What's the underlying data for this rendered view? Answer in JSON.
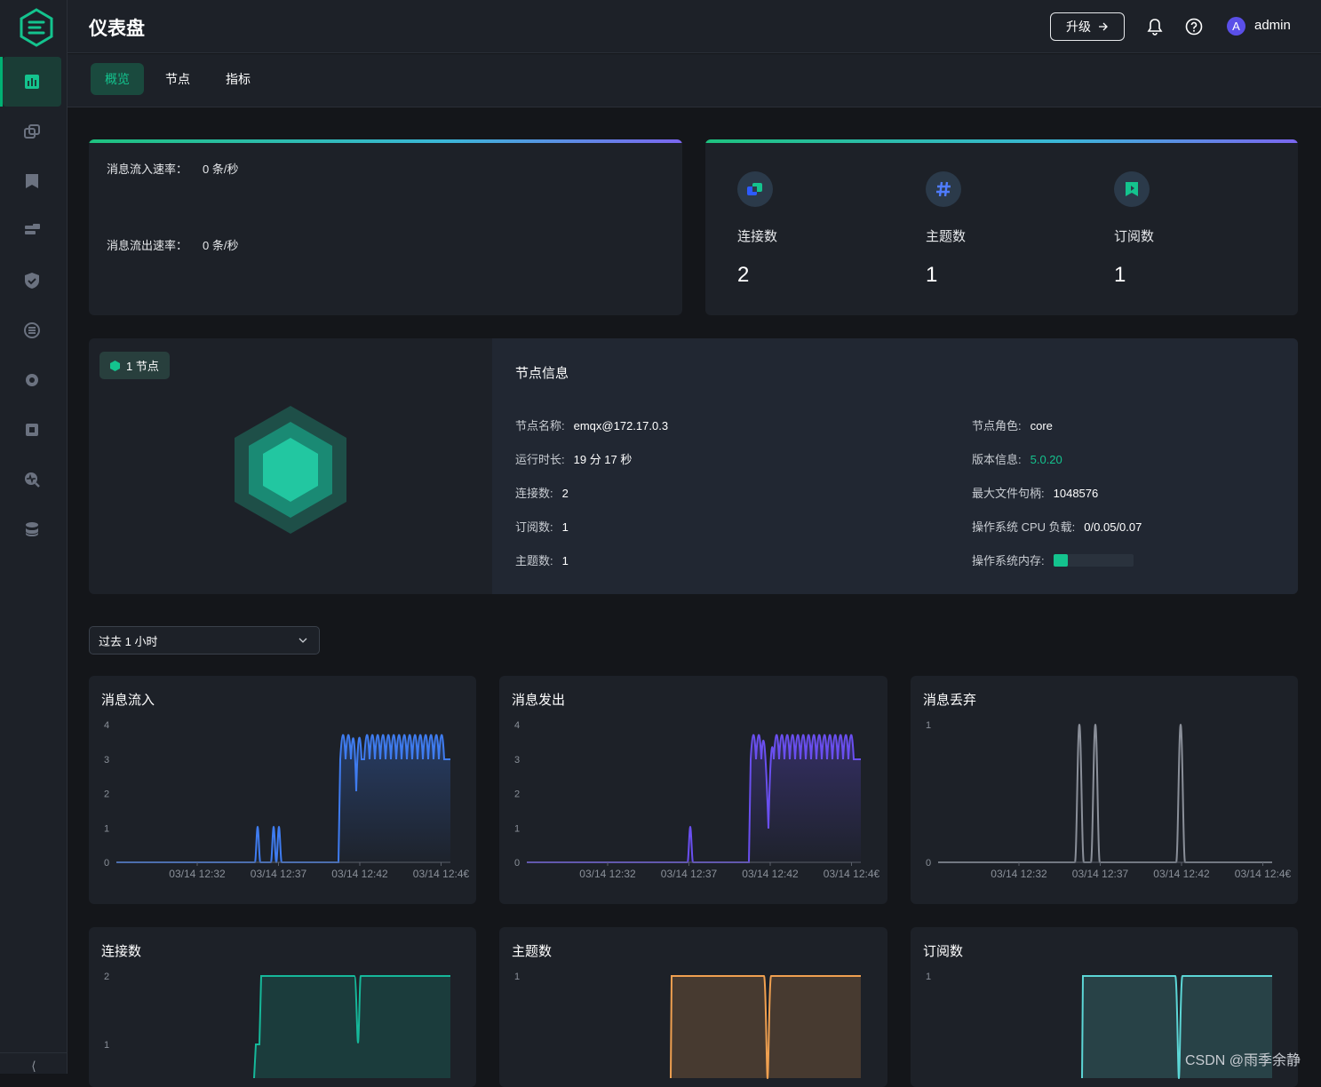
{
  "header": {
    "title": "仪表盘",
    "upgrade_label": "升级",
    "username": "admin",
    "avatar_letter": "A"
  },
  "sidebar": {
    "items": [
      {
        "icon": "dashboard-icon",
        "active": true
      },
      {
        "icon": "connections-icon"
      },
      {
        "icon": "subscribe-icon"
      },
      {
        "icon": "retained-messages-icon"
      },
      {
        "icon": "access-control-icon"
      },
      {
        "icon": "integration-icon"
      },
      {
        "icon": "management-icon"
      },
      {
        "icon": "problem-analysis-icon"
      },
      {
        "icon": "diagnose-icon"
      },
      {
        "icon": "cluster-icon"
      }
    ],
    "collapse_label": "⟨"
  },
  "tabs": [
    {
      "label": "概览",
      "active": true
    },
    {
      "label": "节点"
    },
    {
      "label": "指标"
    }
  ],
  "rates": {
    "in_label": "消息流入速率：",
    "in_value": "0 条/秒",
    "out_label": "消息流出速率：",
    "out_value": "0 条/秒"
  },
  "stats": [
    {
      "icon": "connections-stat-icon",
      "label": "连接数",
      "value": "2"
    },
    {
      "icon": "topics-stat-icon",
      "label": "主题数",
      "value": "1"
    },
    {
      "icon": "subscriptions-stat-icon",
      "label": "订阅数",
      "value": "1"
    }
  ],
  "node_badge": "1 节点",
  "node_info": {
    "title": "节点信息",
    "left": [
      {
        "key": "节点名称:",
        "value": "emqx@172.17.0.3"
      },
      {
        "key": "运行时长:",
        "value": "19 分 17 秒"
      },
      {
        "key": "连接数:",
        "value": "2"
      },
      {
        "key": "订阅数:",
        "value": "1"
      },
      {
        "key": "主题数:",
        "value": "1"
      }
    ],
    "right": [
      {
        "key": "节点角色:",
        "value": "core"
      },
      {
        "key": "版本信息:",
        "value": "5.0.20"
      },
      {
        "key": "最大文件句柄:",
        "value": "1048576"
      },
      {
        "key": "操作系统 CPU 负载:",
        "value": "0/0.05/0.07"
      },
      {
        "key": "操作系统内存:",
        "value": ""
      }
    ],
    "memory_fraction": 0.18
  },
  "time_range": {
    "selected": "过去 1 小时"
  },
  "colors": {
    "accent": "#14c38e",
    "blue": "#3f7cf0",
    "purple": "#6a4ff0",
    "gray": "#8a8f99",
    "teal": "#16b89a",
    "orange": "#f0a050",
    "cyan": "#5cd6d6"
  },
  "chart_data": [
    {
      "type": "line",
      "title": "消息流入",
      "x": [
        "03/14 12:32",
        "03/14 12:37",
        "03/14 12:42",
        "03/14 12:4€"
      ],
      "yticks": [
        0,
        1,
        2,
        3,
        4
      ],
      "ylim": [
        0,
        4
      ]
    },
    {
      "type": "line",
      "title": "消息发出",
      "x": [
        "03/14 12:32",
        "03/14 12:37",
        "03/14 12:42",
        "03/14 12:4€"
      ],
      "yticks": [
        0,
        1,
        2,
        3,
        4
      ],
      "ylim": [
        0,
        4
      ]
    },
    {
      "type": "line",
      "title": "消息丢弃",
      "x": [
        "03/14 12:32",
        "03/14 12:37",
        "03/14 12:42",
        "03/14 12:4€"
      ],
      "yticks": [
        0,
        1
      ],
      "ylim": [
        0,
        1
      ]
    },
    {
      "type": "area",
      "title": "连接数",
      "yticks": [
        1,
        2
      ]
    },
    {
      "type": "area",
      "title": "主题数",
      "yticks": [
        1
      ]
    },
    {
      "type": "area",
      "title": "订阅数",
      "yticks": [
        1
      ]
    }
  ],
  "watermark": "CSDN @雨季余静"
}
